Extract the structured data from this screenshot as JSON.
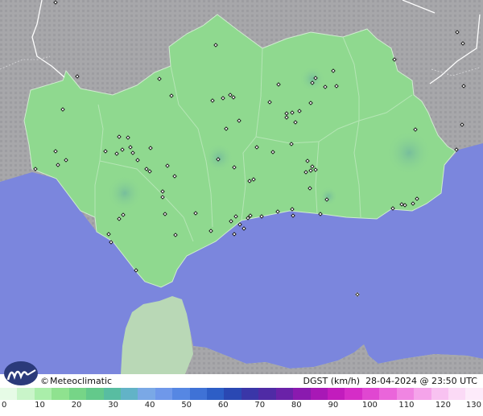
{
  "brand": {
    "copyright_symbol": "©",
    "name": "Meteoclimatic"
  },
  "info": {
    "variable": "DGST (km/h)",
    "datetime": "28-04-2024 @ 23:50 UTC"
  },
  "colors": {
    "sea": "#7b86dd",
    "land_other": "#a3a3a6",
    "region_fill": "#8fd98f",
    "north_africa": "#b8d8b4"
  },
  "legend": {
    "ticks": [
      "0",
      "10",
      "20",
      "30",
      "40",
      "50",
      "60",
      "70",
      "80",
      "90",
      "100",
      "110",
      "120",
      "130"
    ],
    "colors": [
      "#e6fbe6",
      "#c9f5c9",
      "#aaeeaa",
      "#8fe28f",
      "#76d587",
      "#63c98b",
      "#58bda1",
      "#62b3c7",
      "#7aa8e6",
      "#6f98ea",
      "#5687e3",
      "#3f72d6",
      "#2d5ec6",
      "#2a48b3",
      "#3a36a8",
      "#4f2ba5",
      "#6a22a8",
      "#8a1aaf",
      "#a818b6",
      "#c21cbd",
      "#d52dc7",
      "#e047d1",
      "#ea65da",
      "#f085e2",
      "#f5a4ea",
      "#f8c2f1",
      "#fbdaf6",
      "#fdebfa"
    ]
  },
  "stations": [
    [
      69,
      3
    ],
    [
      268,
      56
    ],
    [
      96,
      95
    ],
    [
      198,
      98
    ],
    [
      213,
      119
    ],
    [
      78,
      136
    ],
    [
      264,
      125
    ],
    [
      277,
      122
    ],
    [
      286,
      118
    ],
    [
      290,
      121
    ],
    [
      346,
      105
    ],
    [
      392,
      97
    ],
    [
      388,
      103
    ],
    [
      414,
      88
    ],
    [
      418,
      107
    ],
    [
      404,
      108
    ],
    [
      490,
      74
    ],
    [
      575,
      54
    ],
    [
      568,
      40
    ],
    [
      576,
      107
    ],
    [
      574,
      155
    ],
    [
      516,
      161
    ],
    [
      567,
      186
    ],
    [
      148,
      170
    ],
    [
      159,
      171
    ],
    [
      152,
      186
    ],
    [
      162,
      183
    ],
    [
      145,
      191
    ],
    [
      165,
      190
    ],
    [
      187,
      184
    ],
    [
      131,
      188
    ],
    [
      171,
      199
    ],
    [
      69,
      188
    ],
    [
      82,
      199
    ],
    [
      44,
      210
    ],
    [
      72,
      205
    ],
    [
      186,
      213
    ],
    [
      182,
      210
    ],
    [
      208,
      206
    ],
    [
      217,
      219
    ],
    [
      271,
      198
    ],
    [
      297,
      150
    ],
    [
      281,
      160
    ],
    [
      291,
      208
    ],
    [
      319,
      183
    ],
    [
      335,
      127
    ],
    [
      356,
      146
    ],
    [
      356,
      141
    ],
    [
      363,
      140
    ],
    [
      372,
      138
    ],
    [
      386,
      128
    ],
    [
      367,
      152
    ],
    [
      362,
      179
    ],
    [
      339,
      189
    ],
    [
      315,
      223
    ],
    [
      310,
      225
    ],
    [
      382,
      200
    ],
    [
      388,
      207
    ],
    [
      380,
      214
    ],
    [
      386,
      212
    ],
    [
      392,
      211
    ],
    [
      385,
      234
    ],
    [
      406,
      248
    ],
    [
      202,
      238
    ],
    [
      202,
      245
    ],
    [
      148,
      272
    ],
    [
      153,
      267
    ],
    [
      135,
      291
    ],
    [
      138,
      301
    ],
    [
      243,
      265
    ],
    [
      205,
      266
    ],
    [
      218,
      292
    ],
    [
      262,
      287
    ],
    [
      293,
      269
    ],
    [
      298,
      279
    ],
    [
      287,
      275
    ],
    [
      291,
      291
    ],
    [
      303,
      284
    ],
    [
      308,
      271
    ],
    [
      311,
      268
    ],
    [
      325,
      269
    ],
    [
      345,
      263
    ],
    [
      363,
      260
    ],
    [
      364,
      268
    ],
    [
      398,
      266
    ],
    [
      488,
      259
    ],
    [
      499,
      254
    ],
    [
      503,
      255
    ],
    [
      513,
      253
    ],
    [
      518,
      247
    ],
    [
      169,
      336
    ],
    [
      444,
      366
    ]
  ]
}
